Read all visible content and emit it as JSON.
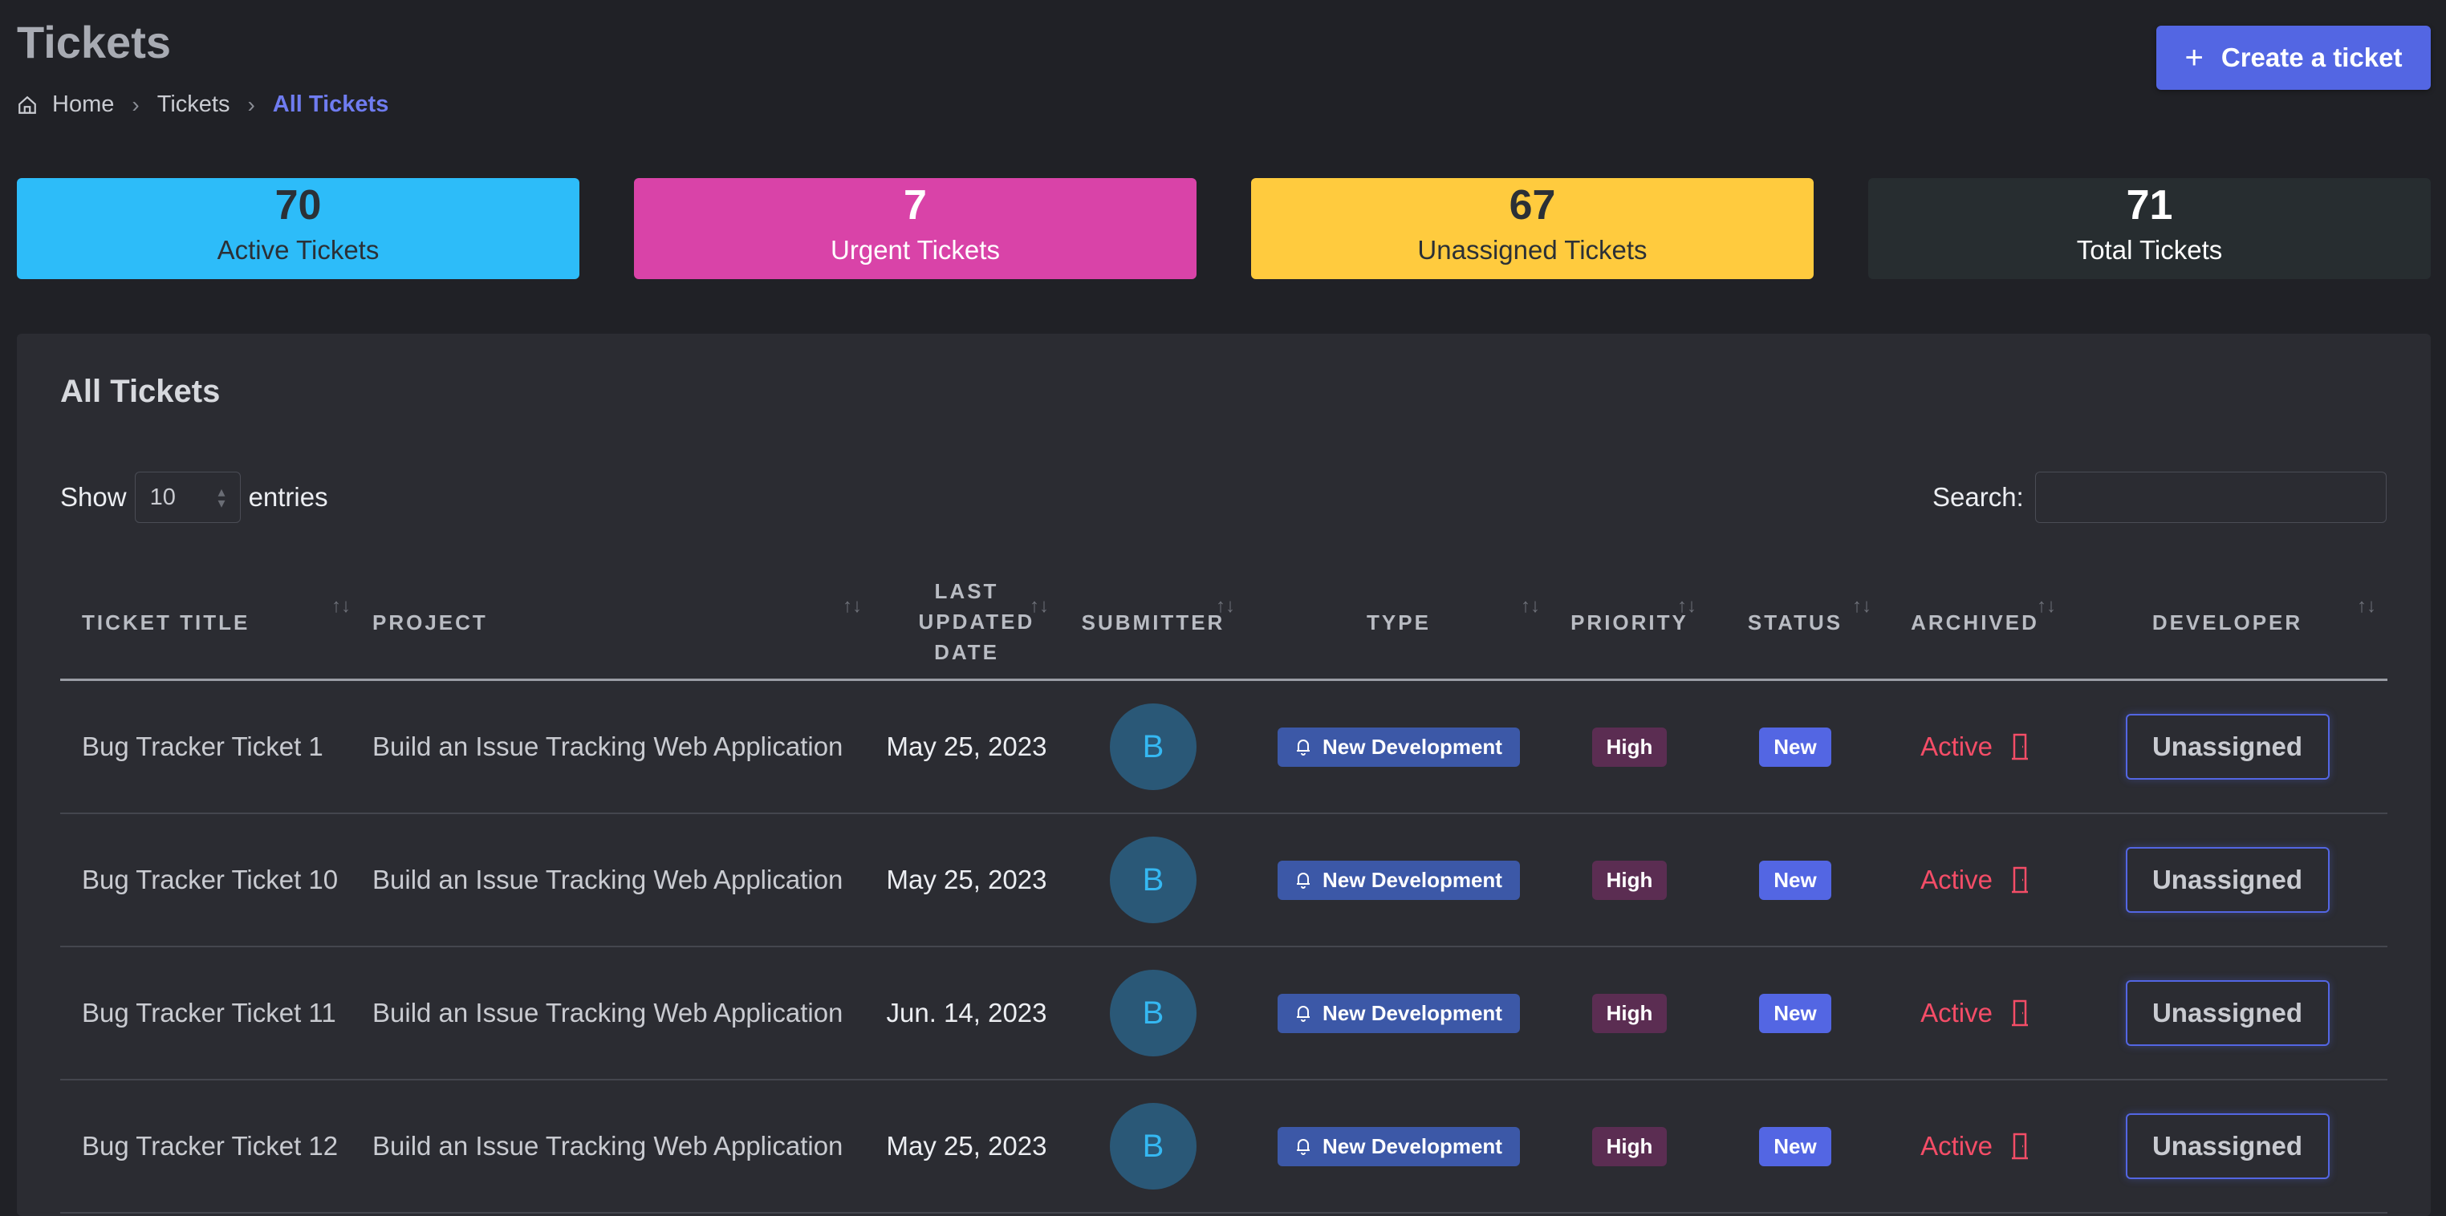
{
  "header": {
    "title": "Tickets",
    "breadcrumb": [
      "Home",
      "Tickets",
      "All Tickets"
    ],
    "create_button": "Create a ticket"
  },
  "stats": [
    {
      "value": "70",
      "label": "Active Tickets",
      "color": "#2dbcf9"
    },
    {
      "value": "7",
      "label": "Urgent Tickets",
      "color": "#d943a8"
    },
    {
      "value": "67",
      "label": "Unassigned Tickets",
      "color": "#ffcb3e"
    },
    {
      "value": "71",
      "label": "Total Tickets",
      "color": "#272d30"
    }
  ],
  "table_card": {
    "title": "All Tickets",
    "show_label": "Show",
    "entries_value": "10",
    "entries_label": "entries",
    "search_label": "Search:",
    "search_value": ""
  },
  "columns": [
    "Ticket Title",
    "Project",
    "Last Updated Date",
    "Submitter",
    "Type",
    "Priority",
    "Status",
    "Archived",
    "Developer"
  ],
  "rows": [
    {
      "title": "Bug Tracker Ticket 1",
      "project": "Build an Issue Tracking Web Application",
      "date": "May 25, 2023",
      "submitter": "B",
      "type": "New Development",
      "priority": "High",
      "status": "New",
      "archived": "Active",
      "developer": "Unassigned"
    },
    {
      "title": "Bug Tracker Ticket 10",
      "project": "Build an Issue Tracking Web Application",
      "date": "May 25, 2023",
      "submitter": "B",
      "type": "New Development",
      "priority": "High",
      "status": "New",
      "archived": "Active",
      "developer": "Unassigned"
    },
    {
      "title": "Bug Tracker Ticket 11",
      "project": "Build an Issue Tracking Web Application",
      "date": "Jun. 14, 2023",
      "submitter": "B",
      "type": "New Development",
      "priority": "High",
      "status": "New",
      "archived": "Active",
      "developer": "Unassigned"
    },
    {
      "title": "Bug Tracker Ticket 12",
      "project": "Build an Issue Tracking Web Application",
      "date": "May 25, 2023",
      "submitter": "B",
      "type": "New Development",
      "priority": "High",
      "status": "New",
      "archived": "Active",
      "developer": "Unassigned"
    }
  ],
  "icons": {
    "home": "home-icon",
    "chevron": "chevron-right-icon",
    "plus": "plus-icon",
    "sort": "sort-icon",
    "bell": "bell-icon",
    "door": "door-icon"
  }
}
